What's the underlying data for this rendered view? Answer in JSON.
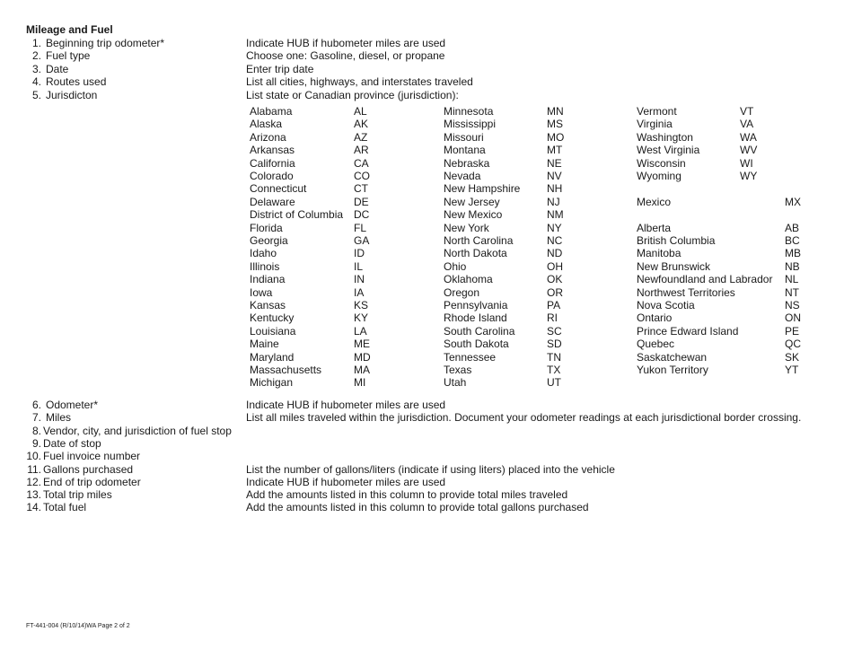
{
  "title": "Mileage and Fuel",
  "items_top": [
    {
      "num": "1.",
      "label": "Beginning trip odometer*",
      "desc": "Indicate HUB if hubometer miles are used"
    },
    {
      "num": "2.",
      "label": "Fuel type",
      "desc": "Choose one: Gasoline, diesel, or propane"
    },
    {
      "num": "3.",
      "label": "Date",
      "desc": "Enter trip date"
    },
    {
      "num": "4.",
      "label": "Routes used",
      "desc": "List all cities, highways, and interstates traveled"
    },
    {
      "num": "5.",
      "label": "Jurisdicton",
      "desc": "List state or Canadian province (jurisdiction):"
    }
  ],
  "jurisdictions": {
    "col1": [
      {
        "name": "Alabama",
        "code": "AL"
      },
      {
        "name": "Alaska",
        "code": "AK"
      },
      {
        "name": "Arizona",
        "code": "AZ"
      },
      {
        "name": "Arkansas",
        "code": "AR"
      },
      {
        "name": "California",
        "code": "CA"
      },
      {
        "name": "Colorado",
        "code": "CO"
      },
      {
        "name": "Connecticut",
        "code": "CT"
      },
      {
        "name": "Delaware",
        "code": "DE"
      },
      {
        "name": "District of Columbia",
        "code": "DC"
      },
      {
        "name": "Florida",
        "code": "FL"
      },
      {
        "name": "Georgia",
        "code": "GA"
      },
      {
        "name": "Idaho",
        "code": "ID"
      },
      {
        "name": "Illinois",
        "code": "IL"
      },
      {
        "name": "Indiana",
        "code": "IN"
      },
      {
        "name": "Iowa",
        "code": "IA"
      },
      {
        "name": "Kansas",
        "code": "KS"
      },
      {
        "name": "Kentucky",
        "code": "KY"
      },
      {
        "name": "Louisiana",
        "code": "LA"
      },
      {
        "name": "Maine",
        "code": "ME"
      },
      {
        "name": "Maryland",
        "code": "MD"
      },
      {
        "name": "Massachusetts",
        "code": "MA"
      },
      {
        "name": "Michigan",
        "code": "MI"
      }
    ],
    "col2": [
      {
        "name": "Minnesota",
        "code": "MN"
      },
      {
        "name": "Mississippi",
        "code": "MS"
      },
      {
        "name": "Missouri",
        "code": "MO"
      },
      {
        "name": "Montana",
        "code": "MT"
      },
      {
        "name": "Nebraska",
        "code": "NE"
      },
      {
        "name": "Nevada",
        "code": "NV"
      },
      {
        "name": "New Hampshire",
        "code": "NH"
      },
      {
        "name": "New Jersey",
        "code": "NJ"
      },
      {
        "name": "New Mexico",
        "code": "NM"
      },
      {
        "name": "New York",
        "code": "NY"
      },
      {
        "name": "North Carolina",
        "code": "NC"
      },
      {
        "name": "North Dakota",
        "code": "ND"
      },
      {
        "name": "Ohio",
        "code": "OH"
      },
      {
        "name": "Oklahoma",
        "code": "OK"
      },
      {
        "name": "Oregon",
        "code": "OR"
      },
      {
        "name": "Pennsylvania",
        "code": "PA"
      },
      {
        "name": "Rhode Island",
        "code": "RI"
      },
      {
        "name": "South Carolina",
        "code": "SC"
      },
      {
        "name": "South Dakota",
        "code": "SD"
      },
      {
        "name": "Tennessee",
        "code": "TN"
      },
      {
        "name": "Texas",
        "code": "TX"
      },
      {
        "name": "Utah",
        "code": "UT"
      }
    ],
    "col3_states": [
      {
        "name": "Vermont",
        "code": "VT"
      },
      {
        "name": "Virginia",
        "code": "VA"
      },
      {
        "name": "Washington",
        "code": "WA"
      },
      {
        "name": "West Virginia",
        "code": "WV"
      },
      {
        "name": "Wisconsin",
        "code": "WI"
      },
      {
        "name": "Wyoming",
        "code": "WY"
      }
    ],
    "mexico": {
      "name": "Mexico",
      "code": "MX"
    },
    "canada": [
      {
        "name": "Alberta",
        "code": "AB"
      },
      {
        "name": "British Columbia",
        "code": "BC"
      },
      {
        "name": "Manitoba",
        "code": "MB"
      },
      {
        "name": "New Brunswick",
        "code": "NB"
      },
      {
        "name": "Newfoundland and Labrador",
        "code": "NL"
      },
      {
        "name": "Northwest Territories",
        "code": "NT"
      },
      {
        "name": "Nova Scotia",
        "code": "NS"
      },
      {
        "name": "Ontario",
        "code": "ON"
      },
      {
        "name": "Prince Edward Island",
        "code": "PE"
      },
      {
        "name": "Quebec",
        "code": "QC"
      },
      {
        "name": "Saskatchewan",
        "code": "SK"
      },
      {
        "name": "Yukon Territory",
        "code": "YT"
      }
    ]
  },
  "items_bottom": [
    {
      "num": "6.",
      "label": "Odometer*",
      "desc": "Indicate HUB if hubometer miles are used"
    },
    {
      "num": "7.",
      "label": "Miles",
      "desc": "List all miles traveled within the jurisdiction. Document your odometer readings at each jurisdictional border crossing."
    },
    {
      "num": "8.",
      "label": "Vendor, city, and jurisdiction of fuel stop",
      "desc": ""
    },
    {
      "num": "9.",
      "label": "Date of stop",
      "desc": ""
    },
    {
      "num": "10.",
      "label": "Fuel invoice number",
      "desc": ""
    },
    {
      "num": "11.",
      "label": "Gallons purchased",
      "desc": "List the number of gallons/liters (indicate if using liters) placed into the vehicle"
    },
    {
      "num": "12.",
      "label": "End of trip odometer",
      "desc": "Indicate HUB if hubometer miles are used"
    },
    {
      "num": "13.",
      "label": "Total trip miles",
      "desc": "Add the amounts listed in this column to provide total miles traveled"
    },
    {
      "num": "14.",
      "label": "Total fuel",
      "desc": "Add the amounts listed in this column to provide total gallons purchased"
    }
  ],
  "footer": "FT-441-004 (R/10/14)WA Page 2 of 2"
}
